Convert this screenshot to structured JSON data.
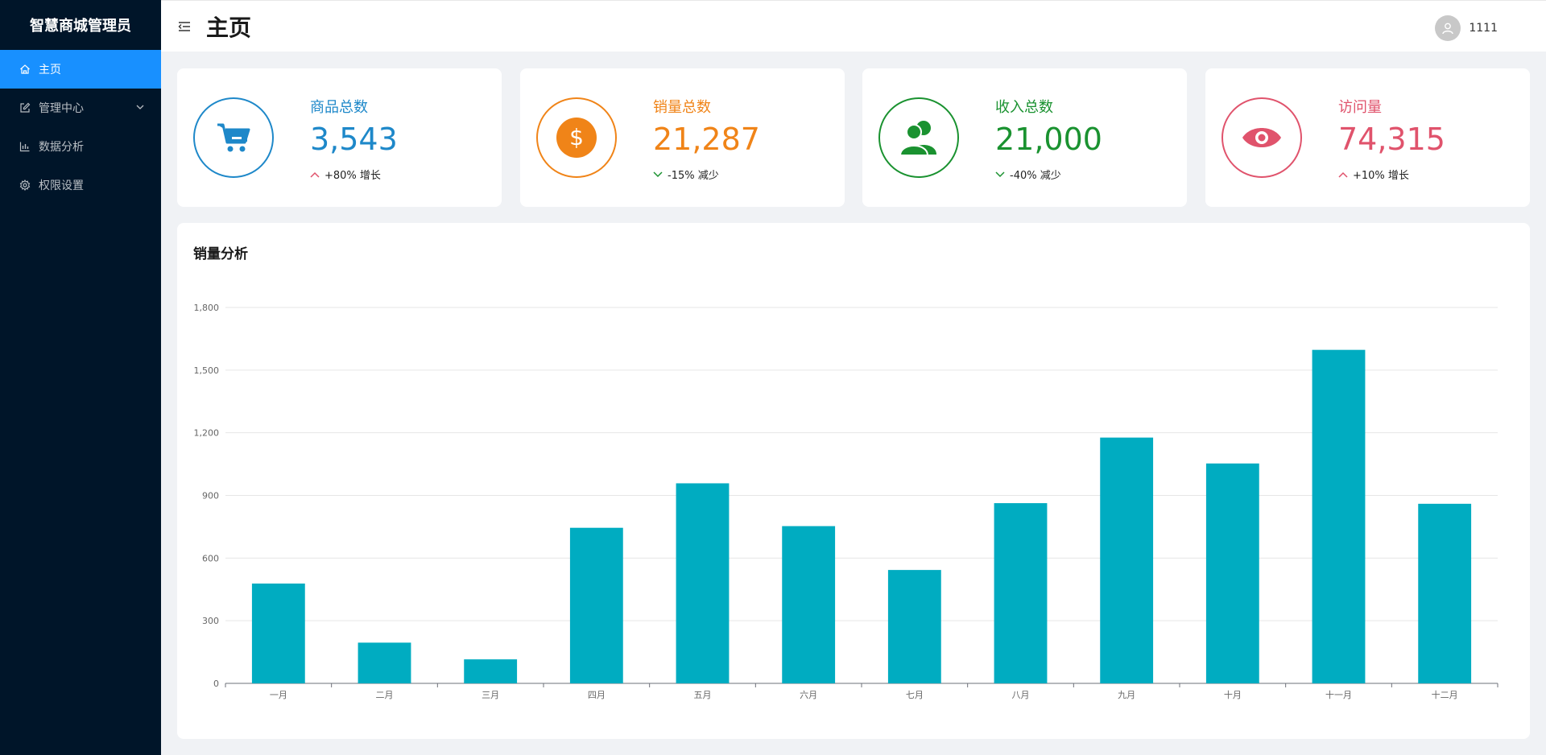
{
  "app": {
    "brand": "智慧商城管理员"
  },
  "sidebar": {
    "items": [
      {
        "label": "主页",
        "icon": "home-icon"
      },
      {
        "label": "管理中心",
        "icon": "edit-icon"
      },
      {
        "label": "数据分析",
        "icon": "bar-chart-icon"
      },
      {
        "label": "权限设置",
        "icon": "gear-icon"
      }
    ]
  },
  "header": {
    "title": "主页",
    "username": "1111"
  },
  "stats": [
    {
      "label": "商品总数",
      "value": "3,543",
      "trend": "+80% 增长",
      "direction": "up",
      "color": "#1e88c9",
      "icon": "cart-icon"
    },
    {
      "label": "销量总数",
      "value": "21,287",
      "trend": "-15% 减少",
      "direction": "down",
      "color": "#f08418",
      "icon": "dollar-icon"
    },
    {
      "label": "收入总数",
      "value": "21,000",
      "trend": "-40% 减少",
      "direction": "down",
      "color": "#1a9230",
      "icon": "users-icon"
    },
    {
      "label": "访问量",
      "value": "74,315",
      "trend": "+10% 增长",
      "direction": "up",
      "color": "#e0536c",
      "icon": "eye-icon"
    }
  ],
  "colors": {
    "sidebar_bg": "#001529",
    "active": "#1890ff",
    "bar": "#00acc1",
    "up_arrow": "#e0536c",
    "down_arrow": "#1a9230"
  },
  "chart_section": {
    "title": "销量分析"
  },
  "chart_data": {
    "type": "bar",
    "title": "销量分析",
    "categories": [
      "一月",
      "二月",
      "三月",
      "四月",
      "五月",
      "六月",
      "七月",
      "八月",
      "九月",
      "十月",
      "十一月",
      "十二月"
    ],
    "values": [
      478,
      195,
      115,
      745,
      958,
      753,
      543,
      863,
      1177,
      1053,
      1597,
      860
    ],
    "yticks": [
      "0",
      "300",
      "600",
      "900",
      "1,200",
      "1,500",
      "1,800"
    ],
    "ylim": [
      0,
      1800
    ],
    "grid": true,
    "legend": "none"
  }
}
